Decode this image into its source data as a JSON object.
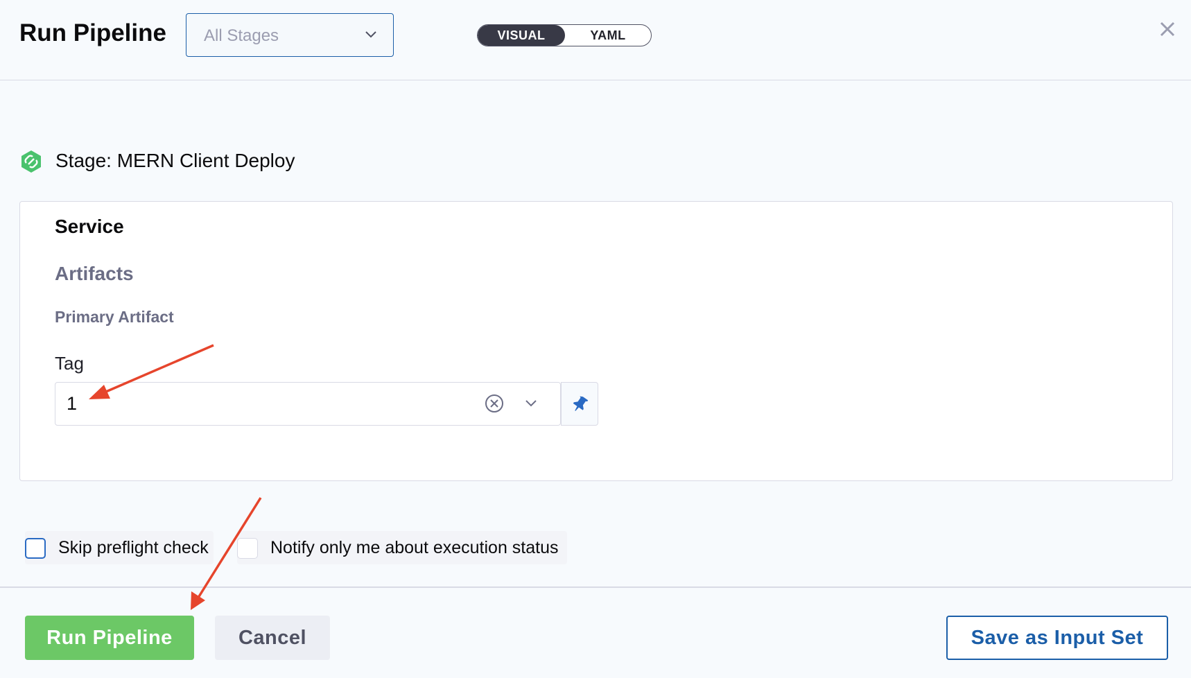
{
  "header": {
    "title": "Run Pipeline",
    "stage_select": {
      "value": "All Stages"
    },
    "view_toggle": {
      "visual": "VISUAL",
      "yaml": "YAML",
      "active": "VISUAL"
    }
  },
  "stage": {
    "label": "Stage: MERN Client Deploy"
  },
  "service": {
    "title": "Service",
    "artifacts": "Artifacts",
    "primary_artifact": "Primary Artifact",
    "tag": {
      "label": "Tag",
      "value": "1"
    }
  },
  "options": {
    "skip_preflight": {
      "label": "Skip preflight check",
      "checked": false
    },
    "notify_only_me": {
      "label": "Notify only me about execution status",
      "checked": false
    }
  },
  "footer": {
    "run_label": "Run Pipeline",
    "cancel_label": "Cancel",
    "save_input_set_label": "Save as Input Set"
  },
  "colors": {
    "primary_blue": "#1b5ea8",
    "run_green": "#6cc866",
    "annotation_red": "#e6452c",
    "stage_icon_green": "#4ac26d"
  },
  "icons": {
    "chevron": "chevron-down-icon",
    "close": "close-icon",
    "clear": "clear-circle-icon",
    "pin": "pin-icon",
    "stage": "deploy-stage-icon"
  }
}
